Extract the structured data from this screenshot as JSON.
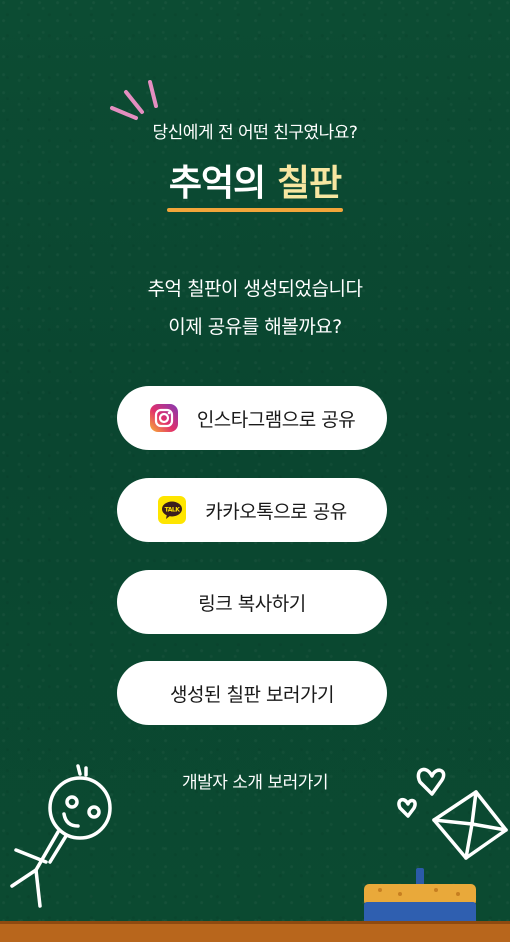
{
  "header": {
    "tagline": "당신에게 전 어떤 친구였나요?",
    "title_main": "추억의 ",
    "title_accent": "칠판"
  },
  "message": {
    "line1": "추억 칠판이 생성되었습니다",
    "line2": "이제 공유를 해볼까요?"
  },
  "buttons": {
    "instagram": {
      "label": "인스타그램으로 공유",
      "icon": "instagram-icon"
    },
    "kakao": {
      "label": "카카오톡으로 공유",
      "icon": "kakaotalk-icon",
      "icon_text": "TALK"
    },
    "copy_link": {
      "label": "링크 복사하기"
    },
    "view_board": {
      "label": "생성된 칠판 보러가기"
    }
  },
  "footer": {
    "developer_link": "개발자 소개 보러가기"
  },
  "colors": {
    "background": "#0b4a31",
    "accent_text": "#f7e6a1",
    "underline": "#f2a53a",
    "ledge": "#b8661c",
    "button_bg": "#ffffff",
    "kakao_yellow": "#fee500"
  }
}
